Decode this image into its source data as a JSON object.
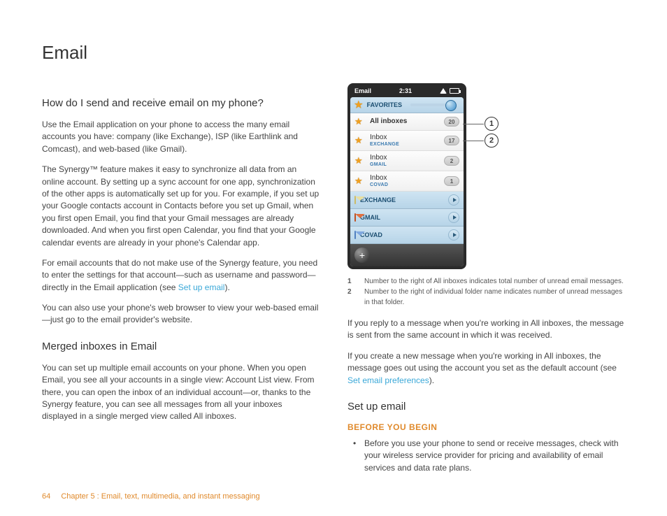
{
  "page": {
    "title": "Email",
    "footer_page": "64",
    "footer_chapter": "Chapter 5 : Email, text, multimedia, and instant messaging"
  },
  "left": {
    "h_send": "How do I send and receive email on my phone?",
    "p1": "Use the Email application on your phone to access the many email accounts you have: company (like Exchange), ISP (like Earthlink and Comcast), and web-based (like Gmail).",
    "p2": "The Synergy™ feature makes it easy to synchronize all data from an online account. By setting up a sync account for one app, synchronization of the other apps is automatically set up for you. For example, if you set up your Google contacts account in Contacts before you set up Gmail, when you first open Email, you find that your Gmail messages are already downloaded. And when you first open Calendar, you find that your Google calendar events are already in your phone's Calendar app.",
    "p3a": "For email accounts that do not make use of the Synergy feature, you need to enter the settings for that account—such as username and password—directly in the Email application (see ",
    "p3link": "Set up email",
    "p3b": ").",
    "p4": "You can also use your phone's web browser to view your web-based email—just go to the email provider's website.",
    "h_merged": "Merged inboxes in Email",
    "p5": "You can set up multiple email accounts on your phone. When you open Email, you see all your accounts in a single view: Account List view. From there, you can open the inbox of an individual account—or, thanks to the Synergy feature, you can see all messages from all your inboxes displayed in a single merged view called All inboxes."
  },
  "phone": {
    "app_label": "Email",
    "time": "2:31",
    "favorites": "FAVORITES",
    "all_inboxes": "All inboxes",
    "all_count": "20",
    "inbox_label": "Inbox",
    "acc1": "EXCHANGE",
    "acc1_count": "17",
    "acc2": "GMAIL",
    "acc2_count": "2",
    "acc3": "COVAD",
    "acc3_count": "1",
    "sec_exchange": "EXCHANGE",
    "sec_gmail": "GMAIL",
    "sec_covad": "COVAD"
  },
  "callouts": {
    "c1": "1",
    "c2": "2"
  },
  "legend": {
    "n1": "1",
    "t1": "Number to the right of All inboxes indicates total number of unread email messages.",
    "n2": "2",
    "t2": "Number to the right of individual folder name indicates number of unread messages in that folder."
  },
  "right": {
    "p_reply": "If you reply to a message when you're working in All inboxes, the message is sent from the same account in which it was received.",
    "p_create_a": "If you create a new message when you're working in All inboxes, the message goes out using the account you set as the default account (see ",
    "p_create_link": "Set email preferences",
    "p_create_b": ").",
    "h_setup": "Set up email",
    "before": "BEFORE YOU BEGIN",
    "bullet1": "Before you use your phone to send or receive messages, check with your wireless service provider for pricing and availability of email services and data rate plans."
  }
}
